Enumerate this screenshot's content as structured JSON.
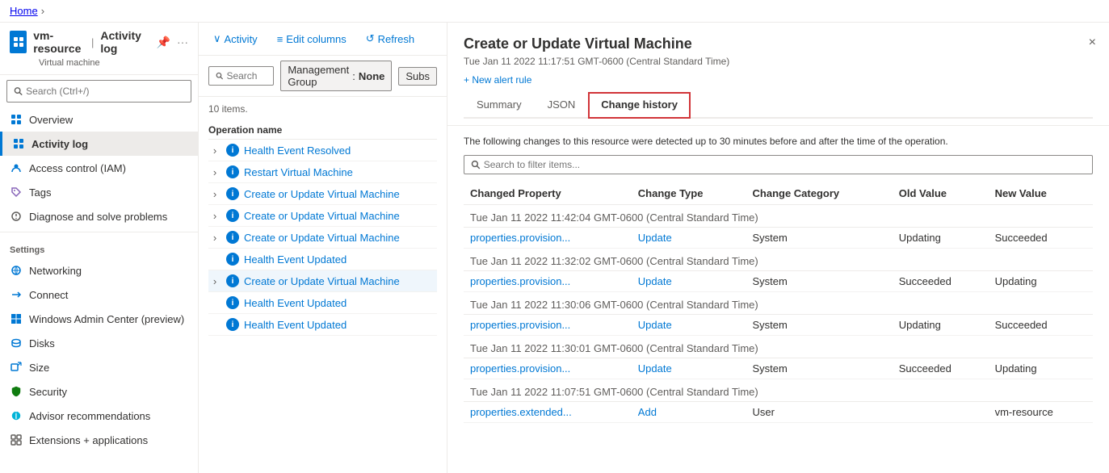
{
  "breadcrumb": {
    "home": "Home",
    "separator": "›"
  },
  "sidebar": {
    "resource_name": "vm-resource",
    "page_title": "Activity log",
    "resource_type": "Virtual machine",
    "search_placeholder": "Search (Ctrl+/)",
    "nav_items": [
      {
        "id": "overview",
        "label": "Overview",
        "icon": "grid"
      },
      {
        "id": "activity-log",
        "label": "Activity log",
        "icon": "list",
        "active": true
      },
      {
        "id": "access-control",
        "label": "Access control (IAM)",
        "icon": "person"
      },
      {
        "id": "tags",
        "label": "Tags",
        "icon": "tag"
      },
      {
        "id": "diagnose",
        "label": "Diagnose and solve problems",
        "icon": "wrench"
      }
    ],
    "settings_label": "Settings",
    "settings_items": [
      {
        "id": "networking",
        "label": "Networking",
        "icon": "network"
      },
      {
        "id": "connect",
        "label": "Connect",
        "icon": "connect"
      },
      {
        "id": "windows-admin",
        "label": "Windows Admin Center (preview)",
        "icon": "windows"
      },
      {
        "id": "disks",
        "label": "Disks",
        "icon": "disk"
      },
      {
        "id": "size",
        "label": "Size",
        "icon": "size"
      },
      {
        "id": "security",
        "label": "Security",
        "icon": "shield"
      },
      {
        "id": "advisor",
        "label": "Advisor recommendations",
        "icon": "advisor"
      },
      {
        "id": "extensions",
        "label": "Extensions + applications",
        "icon": "extensions"
      }
    ]
  },
  "toolbar": {
    "activity_label": "Activity",
    "edit_columns_label": "Edit columns",
    "refresh_label": "Refresh"
  },
  "filters": {
    "search_placeholder": "Search",
    "management_group_label": "Management Group",
    "management_group_value": "None",
    "subscription_label": "Subs"
  },
  "list": {
    "count_label": "10 items.",
    "operation_name_header": "Operation name",
    "items": [
      {
        "id": 1,
        "expandable": true,
        "label": "Health Event Resolved",
        "has_expand": false
      },
      {
        "id": 2,
        "expandable": true,
        "label": "Restart Virtual Machine",
        "has_expand": false
      },
      {
        "id": 3,
        "expandable": true,
        "label": "Create or Update Virtual Machine",
        "has_expand": false
      },
      {
        "id": 4,
        "expandable": true,
        "label": "Create or Update Virtual Machine",
        "has_expand": false
      },
      {
        "id": 5,
        "expandable": true,
        "label": "Create or Update Virtual Machine",
        "has_expand": false
      },
      {
        "id": 6,
        "expandable": false,
        "label": "Health Event Updated",
        "has_expand": false
      },
      {
        "id": 7,
        "expandable": true,
        "label": "Create or Update Virtual Machine",
        "has_expand": true,
        "active": true
      },
      {
        "id": 8,
        "expandable": false,
        "label": "Health Event Updated",
        "has_expand": false
      },
      {
        "id": 9,
        "expandable": false,
        "label": "Health Event Updated",
        "has_expand": false
      }
    ]
  },
  "detail_panel": {
    "title": "Create or Update Virtual Machine",
    "subtitle": "Tue Jan 11 2022 11:17:51 GMT-0600 (Central Standard Time)",
    "new_alert_label": "+ New alert rule",
    "close_label": "×",
    "tabs": [
      {
        "id": "summary",
        "label": "Summary",
        "active": false
      },
      {
        "id": "json",
        "label": "JSON",
        "active": false
      },
      {
        "id": "change-history",
        "label": "Change history",
        "active": true,
        "highlighted": true
      }
    ],
    "description": "The following changes to this resource were detected up to 30 minutes before and after the time of the operation.",
    "filter_placeholder": "Search to filter items...",
    "table_headers": [
      "Changed Property",
      "Change Type",
      "Change Category",
      "Old Value",
      "New Value"
    ],
    "change_groups": [
      {
        "timestamp": "Tue Jan 11 2022 11:42:04 GMT-0600 (Central Standard Time)",
        "rows": [
          {
            "property": "properties.provision...",
            "change_type": "Update",
            "category": "System",
            "old_value": "Updating",
            "new_value": "Succeeded"
          }
        ]
      },
      {
        "timestamp": "Tue Jan 11 2022 11:32:02 GMT-0600 (Central Standard Time)",
        "rows": [
          {
            "property": "properties.provision...",
            "change_type": "Update",
            "category": "System",
            "old_value": "Succeeded",
            "new_value": "Updating"
          }
        ]
      },
      {
        "timestamp": "Tue Jan 11 2022 11:30:06 GMT-0600 (Central Standard Time)",
        "rows": [
          {
            "property": "properties.provision...",
            "change_type": "Update",
            "category": "System",
            "old_value": "Updating",
            "new_value": "Succeeded"
          }
        ]
      },
      {
        "timestamp": "Tue Jan 11 2022 11:30:01 GMT-0600 (Central Standard Time)",
        "rows": [
          {
            "property": "properties.provision...",
            "change_type": "Update",
            "category": "System",
            "old_value": "Succeeded",
            "new_value": "Updating"
          }
        ]
      },
      {
        "timestamp": "Tue Jan 11 2022 11:07:51 GMT-0600 (Central Standard Time)",
        "rows": [
          {
            "property": "properties.extended...",
            "change_type": "Add",
            "category": "User",
            "old_value": "",
            "new_value": "vm-resource"
          }
        ]
      }
    ]
  }
}
